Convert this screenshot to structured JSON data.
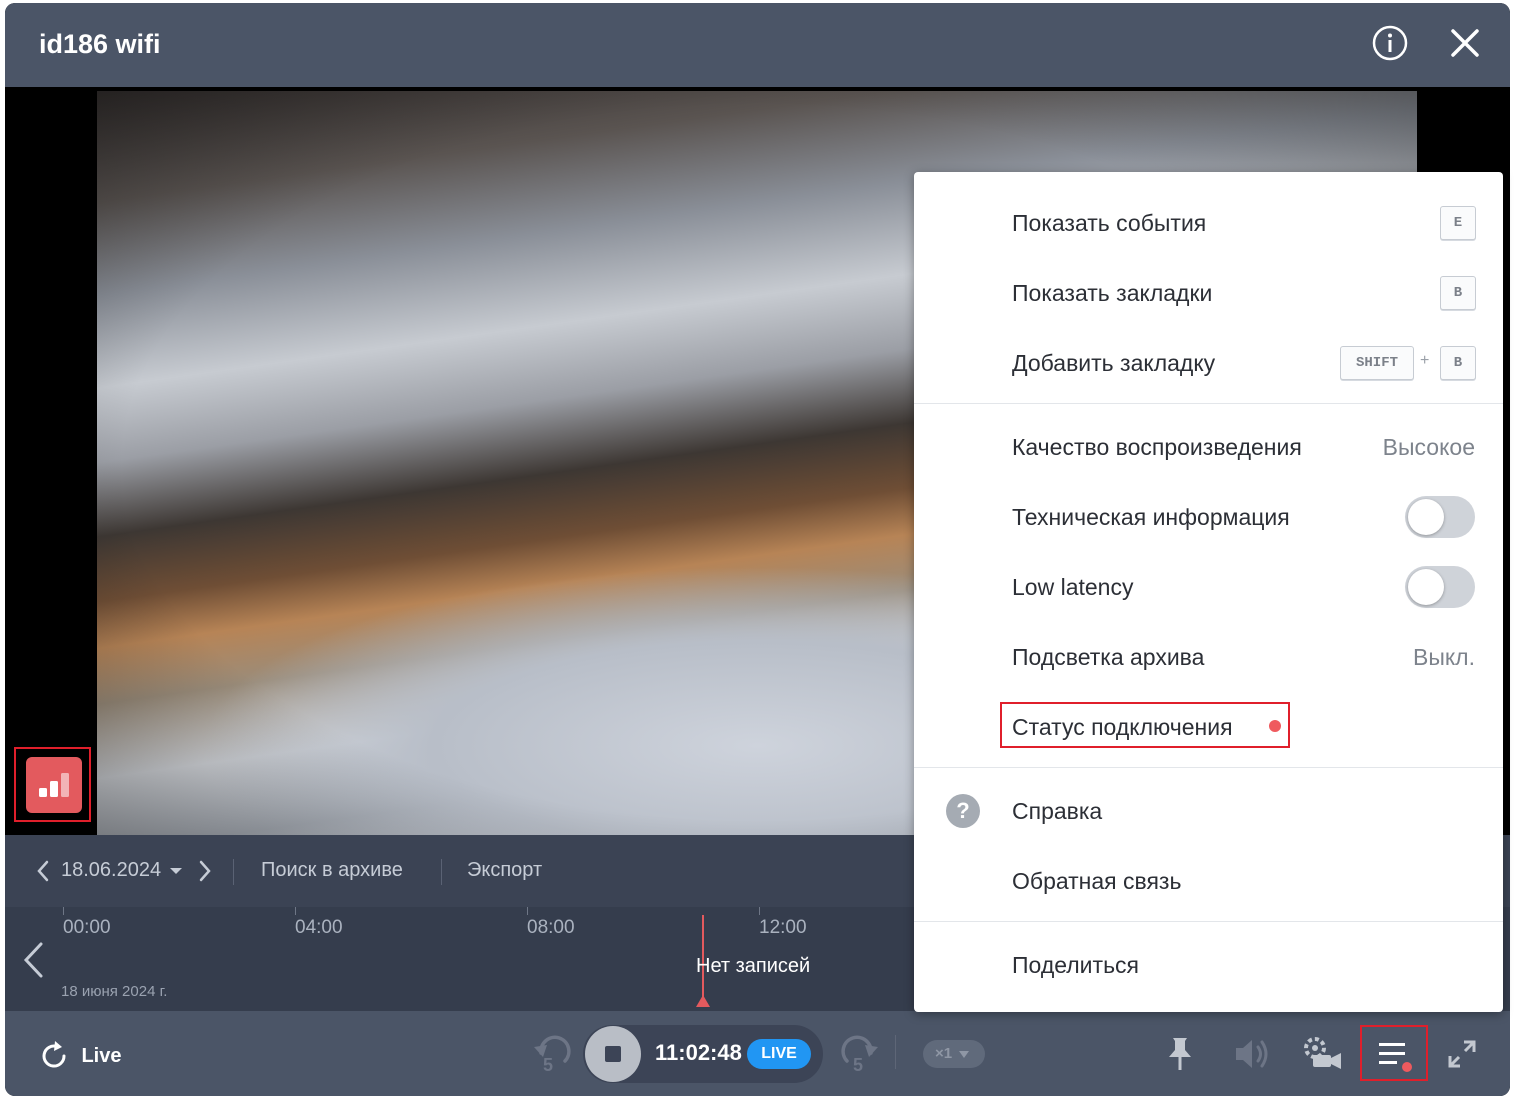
{
  "window": {
    "title": "id186 wifi"
  },
  "nav": {
    "date": "18.06.2024",
    "search_archive": "Поиск в архиве",
    "export": "Экспорт"
  },
  "timeline": {
    "ticks": [
      "00:00",
      "04:00",
      "08:00",
      "12:00"
    ],
    "date_caption": "18 июня 2024 г.",
    "no_records": "Нет записей"
  },
  "controls": {
    "live_label": "Live",
    "skip_back_seconds": "5",
    "skip_forward_seconds": "5",
    "time": "11:02:48",
    "live_badge": "LIVE",
    "speed": "×1"
  },
  "menu": {
    "show_events": "Показать события",
    "show_events_key": "E",
    "show_bookmarks": "Показать закладки",
    "show_bookmarks_key": "B",
    "add_bookmark": "Добавить закладку",
    "add_bookmark_key_1": "SHIFT",
    "add_bookmark_plus": "+",
    "add_bookmark_key_2": "B",
    "playback_quality": "Качество воспроизведения",
    "playback_quality_value": "Высокое",
    "tech_info": "Техническая информация",
    "low_latency": "Low latency",
    "archive_highlight": "Подсветка архива",
    "archive_highlight_value": "Выкл.",
    "connection_status": "Статус подключения",
    "help": "Справка",
    "feedback": "Обратная связь",
    "share": "Поделиться"
  },
  "colors": {
    "titlebar": "#4b5567",
    "nav_bar": "#3b4354",
    "timeline": "#353d4d",
    "accent_live": "#2196f3",
    "alert_red": "#e35a5e",
    "highlight_box": "#e01f2b"
  }
}
